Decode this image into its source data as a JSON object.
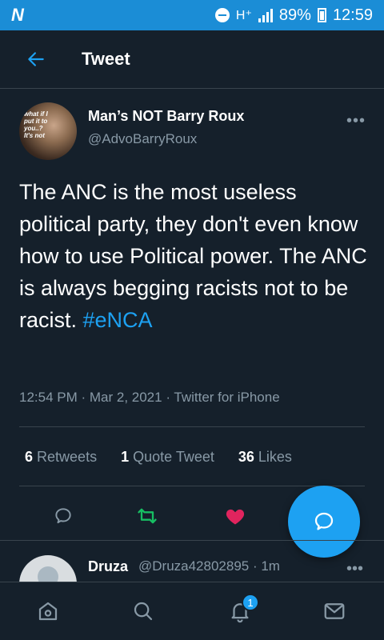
{
  "status_bar": {
    "carrier_logo": "N",
    "network": "H⁺",
    "battery": "89%",
    "time": "12:59"
  },
  "header": {
    "title": "Tweet"
  },
  "tweet": {
    "author_name": "Man’s NOT Barry Roux ⁠",
    "author_handle": "@AdvoBarryRoux",
    "avatar_caption": "what if I put it to you..? It's not",
    "text": "The ANC is the most useless political party, they don't even know how to use Political power. The ANC is always begging racists not to be racist. ",
    "hashtag": "#eNCA",
    "meta": "12:54 PM · Mar 2, 2021 · Twitter for iPhone",
    "stats": {
      "retweets_count": "6",
      "retweets_label": "Retweets",
      "quotes_count": "1",
      "quotes_label": "Quote Tweet",
      "likes_count": "36",
      "likes_label": "Likes"
    }
  },
  "reply": {
    "name": "Druza",
    "handle": "@Druza42802895 · 1m"
  },
  "bottom_nav": {
    "notification_badge": "1"
  },
  "colors": {
    "background": "#15202b",
    "accent": "#1da1f2",
    "status_bar": "#1b8dd6",
    "retweet": "#17bf63",
    "like": "#e0245e",
    "muted_text": "#8899a6"
  }
}
